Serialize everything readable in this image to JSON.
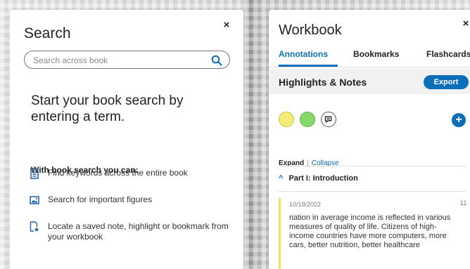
{
  "search_panel": {
    "title": "Search",
    "close_label": "×",
    "search_placeholder": "Search across book",
    "heading": "Start your book search by entering a term.",
    "subheading": "With book search you can:",
    "features": [
      {
        "label": "Find keywords across the entire book",
        "icon": "document-icon"
      },
      {
        "label": "Search for important figures",
        "icon": "image-icon"
      },
      {
        "label": "Locate a saved note, highlight or bookmark from your workbook",
        "icon": "workbook-star-icon"
      }
    ]
  },
  "workbook_panel": {
    "title": "Workbook",
    "close_label": "×",
    "tabs": [
      {
        "label": "Annotations",
        "active": true
      },
      {
        "label": "Bookmarks",
        "active": false
      },
      {
        "label": "Flashcards",
        "active": false
      }
    ],
    "highlights_title": "Highlights & Notes",
    "export_label": "Export",
    "highlight_colors": [
      "#f4ec7a",
      "#87d86b"
    ],
    "add_label": "+",
    "expand_label": "Expand",
    "separator": "|",
    "collapse_label": "Collapse",
    "section": {
      "title": "Part I: Introduction",
      "notes": [
        {
          "date": "10/19/2022",
          "page": "11",
          "text": "riation in average income is reflected in various measures of quality of life. Citizens of high-income countries have more computers, more cars, better nutrition, better healthcare"
        }
      ]
    }
  },
  "colors": {
    "accent": "#0a6fb8",
    "highlight_yellow": "#f4ec7a",
    "highlight_green": "#87d86b"
  }
}
